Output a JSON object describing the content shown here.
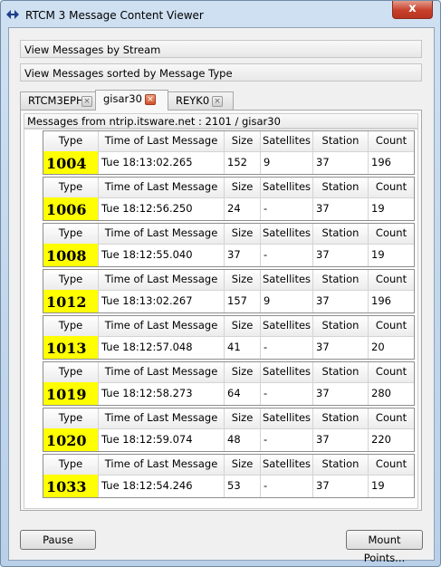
{
  "window": {
    "title": "RTCM 3 Message Content Viewer",
    "close_glyph": "x"
  },
  "groups": [
    "View Messages by Stream",
    "View Messages sorted by Message Type"
  ],
  "tabs": [
    {
      "label": "RTCM3EPH",
      "close": "×"
    },
    {
      "label": "gisar30",
      "close": "×"
    },
    {
      "label": "REYK0",
      "close": "×"
    }
  ],
  "panel": {
    "header": "Messages from ntrip.itsware.net : 2101 / gisar30"
  },
  "columns": [
    "Type",
    "Time of Last Message",
    "Size",
    "Satellites",
    "Station",
    "Count"
  ],
  "messages": [
    {
      "type": "1004",
      "time": "Tue 18:13:02.265",
      "size": "152",
      "satellites": "9",
      "station": "37",
      "count": "196"
    },
    {
      "type": "1006",
      "time": "Tue 18:12:56.250",
      "size": "24",
      "satellites": "-",
      "station": "37",
      "count": "19"
    },
    {
      "type": "1008",
      "time": "Tue 18:12:55.040",
      "size": "37",
      "satellites": "-",
      "station": "37",
      "count": "19"
    },
    {
      "type": "1012",
      "time": "Tue 18:13:02.267",
      "size": "157",
      "satellites": "9",
      "station": "37",
      "count": "196"
    },
    {
      "type": "1013",
      "time": "Tue 18:12:57.048",
      "size": "41",
      "satellites": "-",
      "station": "37",
      "count": "20"
    },
    {
      "type": "1019",
      "time": "Tue 18:12:58.273",
      "size": "64",
      "satellites": "-",
      "station": "37",
      "count": "280"
    },
    {
      "type": "1020",
      "time": "Tue 18:12:59.074",
      "size": "48",
      "satellites": "-",
      "station": "37",
      "count": "220"
    },
    {
      "type": "1033",
      "time": "Tue 18:12:54.246",
      "size": "53",
      "satellites": "-",
      "station": "37",
      "count": "19"
    }
  ],
  "buttons": {
    "pause": "Pause",
    "mount_points": "Mount Points..."
  },
  "colors": {
    "type_highlight": "#ffff00",
    "close_button": "#c7402c"
  }
}
